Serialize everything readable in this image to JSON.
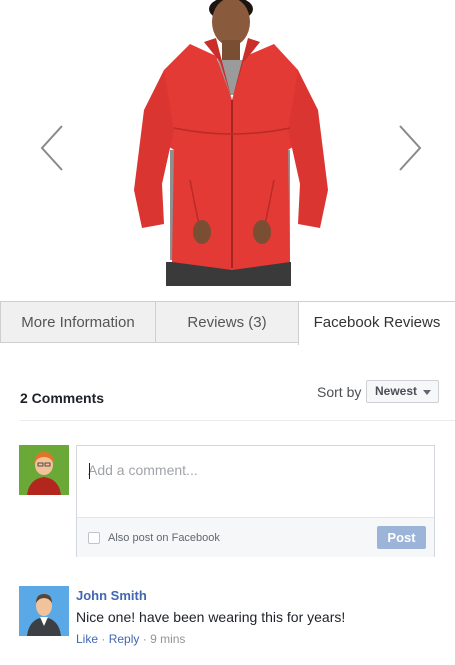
{
  "gallery": {
    "prev_icon": "chevron-left-icon",
    "next_icon": "chevron-right-icon",
    "product_image": "red fleece jacket on model"
  },
  "tabs": [
    {
      "label": "More Information",
      "active": false
    },
    {
      "label": "Reviews (3)",
      "active": false
    },
    {
      "label": "Facebook Reviews",
      "active": true
    }
  ],
  "comments": {
    "count_label": "2 Comments",
    "sort": {
      "label": "Sort by",
      "selected": "Newest"
    },
    "composer": {
      "placeholder": "Add a comment...",
      "checkbox_label": "Also post on Facebook",
      "post_label": "Post"
    },
    "items": [
      {
        "author": "John Smith",
        "text": "Nice one! have been wearing this for years!",
        "like": "Like",
        "sep": "·",
        "reply": "Reply",
        "time": "9 mins"
      }
    ]
  },
  "colors": {
    "fb_link": "#4267b2",
    "post_button": "#9cb4d8",
    "jacket": "#e33a36"
  }
}
